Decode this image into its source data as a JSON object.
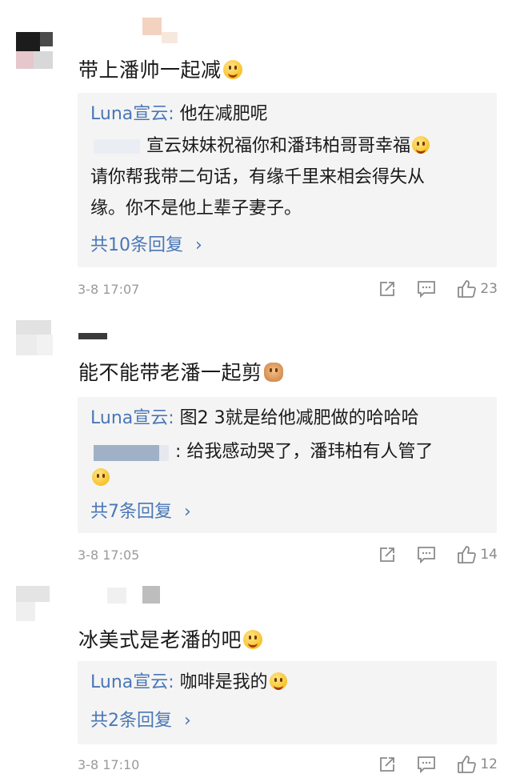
{
  "comments": [
    {
      "text": "带上潘帅一起减",
      "emoji": "grinning-sweat-face",
      "replies": [
        {
          "user": "Luna宣云:",
          "text": " 他在减肥呢"
        },
        {
          "user": "",
          "text": "宣云妹妹祝福你和潘玮柏哥哥幸福"
        },
        {
          "user": "",
          "text": "请你帮我带二句话，有缘千里来相会得失从"
        },
        {
          "user": "",
          "text": "缘。你不是他上辈子妻子。"
        }
      ],
      "more_label": "共10条回复",
      "chevron": "›",
      "date": "3-8 17:07",
      "likes": "23"
    },
    {
      "text": "能不能带老潘一起剪",
      "emoji": "cat-face",
      "replies": [
        {
          "user": "Luna宣云:",
          "text": " 图2 3就是给他减肥做的哈哈哈"
        },
        {
          "user": "",
          "text": ": 给我感动哭了，潘玮柏有人管了"
        }
      ],
      "more_label": "共7条回复",
      "chevron": "›",
      "date": "3-8 17:05",
      "likes": "14"
    },
    {
      "text": "冰美式是老潘的吧",
      "emoji": "smiling-face",
      "replies": [
        {
          "user": "Luna宣云:",
          "text": " 咖啡是我的"
        }
      ],
      "more_label": "共2条回复",
      "chevron": "›",
      "date": "3-8 17:10",
      "likes": "12"
    }
  ],
  "icons": [
    "share-icon",
    "comment-icon",
    "like-icon"
  ],
  "colors": {
    "username": "#4a77b6",
    "reply_bg": "#f4f4f4",
    "meta": "#9a9a9a"
  }
}
